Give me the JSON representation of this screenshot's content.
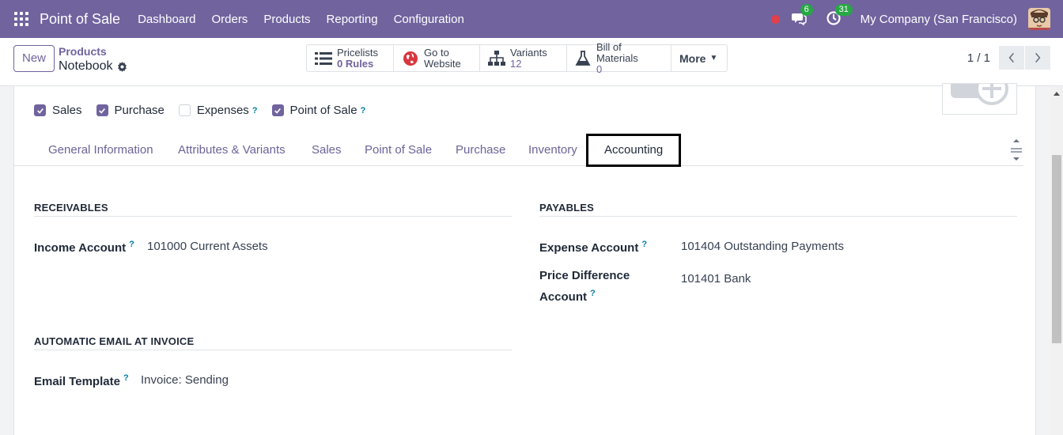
{
  "navbar": {
    "app_name": "Point of Sale",
    "menu": [
      "Dashboard",
      "Orders",
      "Products",
      "Reporting",
      "Configuration"
    ],
    "messages_count": "6",
    "activities_count": "31",
    "company": "My Company (San Francisco)",
    "colors": {
      "bar": "#71639e",
      "badge": "#28a745",
      "record": "#e0404b"
    }
  },
  "control_panel": {
    "new_label": "New",
    "breadcrumb_parent": "Products",
    "record_name": "Notebook",
    "smart_buttons": [
      {
        "icon": "list-icon",
        "line1": "Pricelists",
        "line2_value": "0",
        "line2_label": "Rules"
      },
      {
        "icon": "globe-icon",
        "line1": "Go to",
        "line2_label": "Website"
      },
      {
        "icon": "sitemap-icon",
        "line1": "Variants",
        "line2_value": "12"
      },
      {
        "icon": "flask-icon",
        "line1": "Bill of Materials",
        "line2_value": "0"
      }
    ],
    "more_label": "More",
    "pager": "1 / 1"
  },
  "form": {
    "checkboxes": [
      {
        "label": "Sales",
        "checked": true,
        "help": false
      },
      {
        "label": "Purchase",
        "checked": true,
        "help": false
      },
      {
        "label": "Expenses",
        "checked": false,
        "help": true
      },
      {
        "label": "Point of Sale",
        "checked": true,
        "help": true
      }
    ],
    "help_mark": "?",
    "tabs": [
      "General Information",
      "Attributes & Variants",
      "Sales",
      "Point of Sale",
      "Purchase",
      "Inventory",
      "Accounting"
    ],
    "active_tab": "Accounting",
    "receivables": {
      "title": "RECEIVABLES",
      "income_label": "Income Account",
      "income_value": "101000 Current Assets"
    },
    "payables": {
      "title": "PAYABLES",
      "expense_label": "Expense Account",
      "expense_value": "101404 Outstanding Payments",
      "price_diff_label_1": "Price Difference",
      "price_diff_label_2": "Account",
      "price_diff_value": "101401 Bank"
    },
    "email": {
      "title": "AUTOMATIC EMAIL AT INVOICE",
      "template_label": "Email Template",
      "template_value": "Invoice: Sending"
    }
  }
}
